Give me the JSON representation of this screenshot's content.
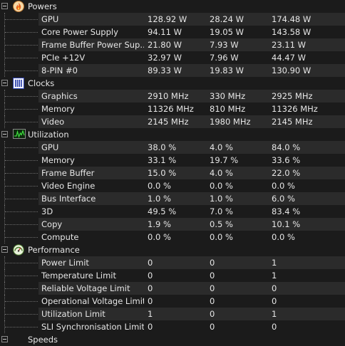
{
  "sections": [
    {
      "key": "powers",
      "title": "Powers",
      "icon": "flame-icon",
      "rows": [
        {
          "name": "GPU",
          "values": [
            "128.92 W",
            "28.24 W",
            "174.48 W"
          ]
        },
        {
          "name": "Core Power Supply",
          "values": [
            "94.11 W",
            "19.05 W",
            "143.58 W"
          ]
        },
        {
          "name": "Frame Buffer Power Sup...",
          "values": [
            "21.80 W",
            "7.93 W",
            "23.11 W"
          ]
        },
        {
          "name": "PCIe +12V",
          "values": [
            "32.97 W",
            "7.96 W",
            "44.47 W"
          ]
        },
        {
          "name": "8-PIN #0",
          "values": [
            "89.33 W",
            "19.83 W",
            "130.90 W"
          ]
        }
      ]
    },
    {
      "key": "clocks",
      "title": "Clocks",
      "icon": "clock-bars-icon",
      "rows": [
        {
          "name": "Graphics",
          "values": [
            "2910 MHz",
            "330 MHz",
            "2925 MHz"
          ]
        },
        {
          "name": "Memory",
          "values": [
            "11326 MHz",
            "810 MHz",
            "11326 MHz"
          ]
        },
        {
          "name": "Video",
          "values": [
            "2145 MHz",
            "1980 MHz",
            "2145 MHz"
          ]
        }
      ]
    },
    {
      "key": "utilization",
      "title": "Utilization",
      "icon": "activity-graph-icon",
      "rows": [
        {
          "name": "GPU",
          "values": [
            "38.0 %",
            "4.0 %",
            "84.0 %"
          ]
        },
        {
          "name": "Memory",
          "values": [
            "33.1 %",
            "19.7 %",
            "33.6 %"
          ]
        },
        {
          "name": "Frame Buffer",
          "values": [
            "15.0 %",
            "4.0 %",
            "22.0 %"
          ]
        },
        {
          "name": "Video Engine",
          "values": [
            "0.0 %",
            "0.0 %",
            "0.0 %"
          ]
        },
        {
          "name": "Bus Interface",
          "values": [
            "1.0 %",
            "1.0 %",
            "6.0 %"
          ]
        },
        {
          "name": "3D",
          "values": [
            "49.5 %",
            "7.0 %",
            "83.4 %"
          ]
        },
        {
          "name": "Copy",
          "values": [
            "1.9 %",
            "0.5 %",
            "10.1 %"
          ]
        },
        {
          "name": "Compute",
          "values": [
            "0.0 %",
            "0.0 %",
            "0.0 %"
          ]
        }
      ]
    },
    {
      "key": "performance",
      "title": "Performance",
      "icon": "gauge-icon",
      "rows": [
        {
          "name": "Power Limit",
          "values": [
            "0",
            "0",
            "1"
          ]
        },
        {
          "name": "Temperature Limit",
          "values": [
            "0",
            "0",
            "1"
          ]
        },
        {
          "name": "Reliable Voltage Limit",
          "values": [
            "0",
            "0",
            "0"
          ]
        },
        {
          "name": "Operational Voltage Limit",
          "values": [
            "0",
            "0",
            "0"
          ]
        },
        {
          "name": "Utilization Limit",
          "values": [
            "1",
            "0",
            "1"
          ]
        },
        {
          "name": "SLI Synchronisation Limit",
          "values": [
            "0",
            "0",
            "0"
          ]
        }
      ]
    }
  ],
  "cut_off_section_title": "Speeds"
}
